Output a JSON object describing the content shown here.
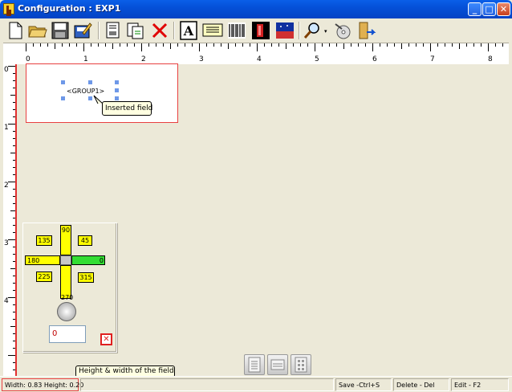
{
  "window": {
    "title": "Configuration : EXP1",
    "minimize": "_",
    "maximize": "□",
    "close": "✕"
  },
  "ruler": {
    "h_labels": [
      "0",
      "1",
      "2",
      "3",
      "4",
      "5",
      "6",
      "7",
      "8"
    ],
    "v_labels": [
      "0",
      "1",
      "2",
      "3",
      "4"
    ]
  },
  "label": {
    "group_text": "<GROUP1>"
  },
  "tooltips": {
    "inserted_field": "Inserted field",
    "size": "Height & width of the field"
  },
  "rotation": {
    "angles": {
      "a0": "0",
      "a45": "45",
      "a90": "90",
      "a135": "135",
      "a180": "180",
      "a225": "225",
      "a270": "270",
      "a315": "315"
    },
    "value": "0",
    "active_angle": "0"
  },
  "statusbar": {
    "size": "Width: 0.83 Height: 0.20",
    "save": "Save -Ctrl+S",
    "delete": "Delete - Del",
    "edit": "Edit - F2"
  },
  "colors": {
    "ruler_red": "#E23030",
    "highlight": "#FFFF00",
    "active": "#33DD33",
    "handles": "#6E98E8"
  }
}
